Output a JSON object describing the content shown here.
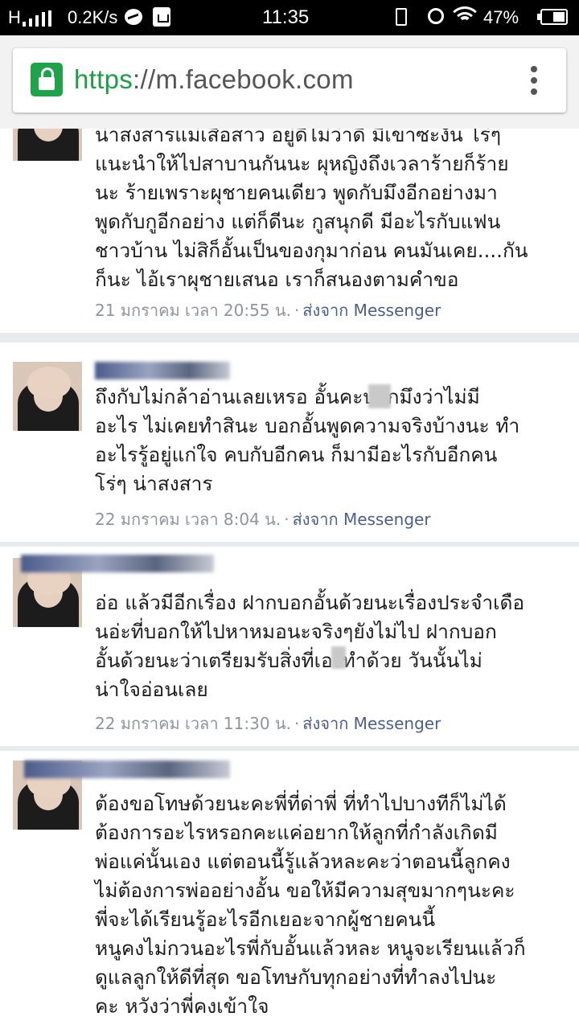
{
  "status_bar": {
    "carrier": "H",
    "network_speed": "0.2K/s",
    "time": "11:35",
    "battery_percent": "47%"
  },
  "browser": {
    "url_scheme": "https",
    "url_rest": "://m.facebook.com"
  },
  "comments": [
    {
      "text": "น่าสงสารแม่เสือสาว อยู่ดีไม่ว่าดี มีเขาซะงัน โร่ๆ\nแนะนำให้ไปสาบานกันนะ ผุหญิงถึงเวลาร้ายก็ร้าย\nนะ ร้ายเพราะผุชายคนเดียว พูดกับมึงอีกอย่างมา\nพูดกับกูอีกอย่าง แต่ก็ดีนะ กูสนุกดี มีอะไรกับแฟน\nชาวบ้าน ไม่สิก็อั้นเป็นของกุมาก่อน คนมันเคย....กัน\nก็นะ ไอ้เราผุชายเสนอ เราก็สนองตามคำขอ",
      "timestamp": "21 มกราคม เวลา 20:55 น.",
      "separator": "·",
      "source": "ส่งจาก Messenger"
    },
    {
      "text": "ถึงกับไม่กล้าอ่านเลยเหรอ อั้นคะบอกมึงว่าไม่มี\nอะไร ไม่เคยทำสินะ บอกอั้นพูดความจริงบ้างนะ ทำ\nอะไรรู้อยู่แก่ใจ คบกับอีกคน ก็มามีอะไรกับอีกคน\nโร่ๆ น่าสงสาร",
      "timestamp": "22 มกราคม เวลา 8:04 น.",
      "separator": "·",
      "source": "ส่งจาก Messenger"
    },
    {
      "text": "อ่อ แล้วมีอีกเรื่อง ฝากบอกอั้นด้วยนะเรื่องประจำเดือ\nนอ่ะที่บอกให้ไปหาหมอนะจริงๆยังไม่ไป ฝากบอก\nอั้นด้วยนะว่าเตรียมรับสิ่งที่เองทำด้วย วันนั้นไม่\nน่าใจอ่อนเลย",
      "timestamp": "22 มกราคม เวลา 11:30 น.",
      "separator": "·",
      "source": "ส่งจาก Messenger"
    },
    {
      "text": "ต้องขอโทษด้วยนะคะพี่ที่ด่าพี่ ที่ทำไปบางทีก็ไม่ได้\nต้องการอะไรหรอกคะแค่อยากให้ลูกที่กำลังเกิดมี\nพ่อแค่นั้นเอง แต่ตอนนี้รู้แล้วหละคะว่าตอนนี้ลูกคง\nไม่ต้องการพ่ออย่างอั้น ขอให้มีความสุขมากๆนะคะ\nพี่จะได้เรียนรู้อะไรอีกเยอะจากผู้ชายคนนี้\nหนูคงไม่กวนอะไรพี่กับอั้นแล้วหละ หนูจะเรียนแล้วก็\nดูแลลูกให้ดีที่สุด ขอโทษกับทุกอย่างที่ทำลงไปนะ\nคะ หวังว่าพี่คงเข้าใจ"
    }
  ]
}
